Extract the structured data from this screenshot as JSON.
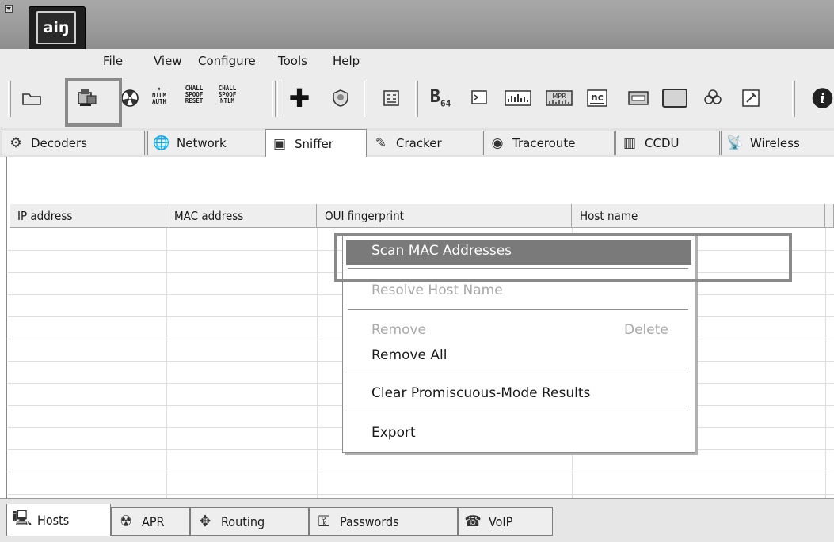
{
  "app": {
    "logo_text": "aiŋ"
  },
  "menu": [
    "File",
    "View",
    "Configure",
    "Tools",
    "Help"
  ],
  "toolbar": {
    "btn_ntlm_auth": "NTLM\nAUTH",
    "btn_chall_spoof_reset": "CHALL\nSPOOF\nRESET",
    "btn_chall_spoof_ntlm": "CHALL\nSPOOF\nNTLM",
    "btn_base64": "B",
    "btn_base64_sub": "64",
    "btn_mpr": "MPR"
  },
  "top_tabs": [
    "Decoders",
    "Network",
    "Sniffer",
    "Cracker",
    "Traceroute",
    "CCDU",
    "Wireless"
  ],
  "table": {
    "columns": [
      "IP address",
      "MAC address",
      "OUI fingerprint",
      "Host name"
    ]
  },
  "context_menu": {
    "scan": "Scan MAC Addresses",
    "resolve": "Resolve Host Name",
    "remove": "Remove",
    "remove_shortcut": "Delete",
    "remove_all": "Remove All",
    "clear": "Clear Promiscuous-Mode Results",
    "export": "Export"
  },
  "bottom_tabs": [
    "Hosts",
    "APR",
    "Routing",
    "Passwords",
    "VoIP"
  ]
}
